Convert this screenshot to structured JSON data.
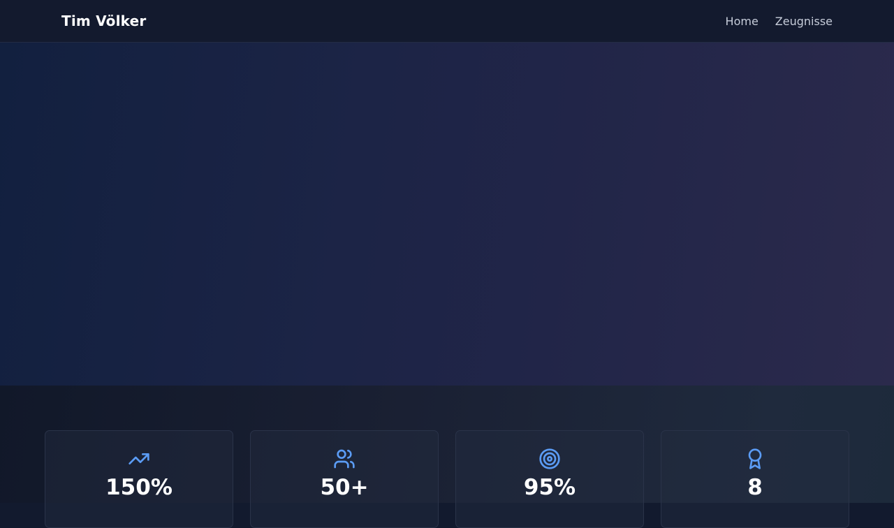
{
  "header": {
    "brand": "Tim Völker",
    "nav": [
      {
        "label": "Home"
      },
      {
        "label": "Zeugnisse"
      }
    ]
  },
  "stats": [
    {
      "icon": "trending-up-icon",
      "value": "150%"
    },
    {
      "icon": "users-icon",
      "value": "50+"
    },
    {
      "icon": "target-icon",
      "value": "95%"
    },
    {
      "icon": "award-icon",
      "value": "8"
    }
  ],
  "colors": {
    "accent": "#5b9cf5",
    "nav_bg": "#131a2e",
    "text": "#ffffff"
  }
}
